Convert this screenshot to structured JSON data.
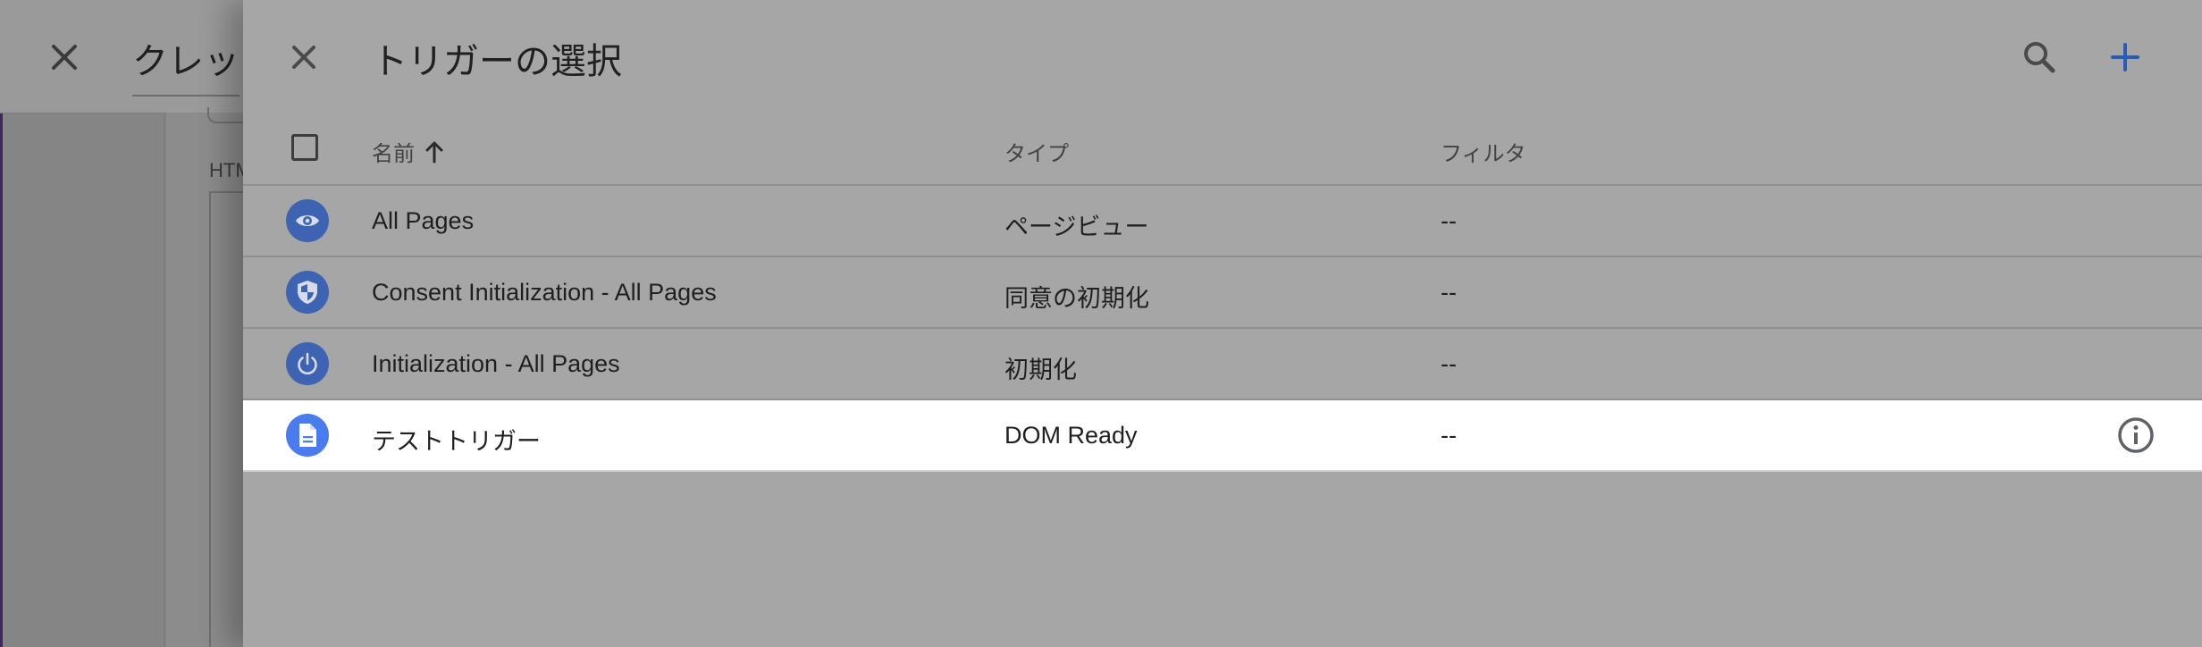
{
  "background_page": {
    "title": "クレッ",
    "html_label": "HTML"
  },
  "panel": {
    "title": "トリガーの選択"
  },
  "table": {
    "columns": {
      "name": "名前",
      "type": "タイプ",
      "filter": "フィルタ"
    },
    "rows": [
      {
        "name": "All Pages",
        "type": "ページビュー",
        "filter": "--",
        "icon": "eye-icon"
      },
      {
        "name": "Consent Initialization - All Pages",
        "type": "同意の初期化",
        "filter": "--",
        "icon": "shield-icon"
      },
      {
        "name": "Initialization - All Pages",
        "type": "初期化",
        "filter": "--",
        "icon": "power-icon"
      },
      {
        "name": "テストトリガー",
        "type": "DOM Ready",
        "filter": "--",
        "icon": "document-icon"
      }
    ]
  },
  "colors": {
    "accent": "#1a73e8",
    "icon_dimmed": "#3e63b3",
    "icon_active": "#4a7cf0"
  }
}
